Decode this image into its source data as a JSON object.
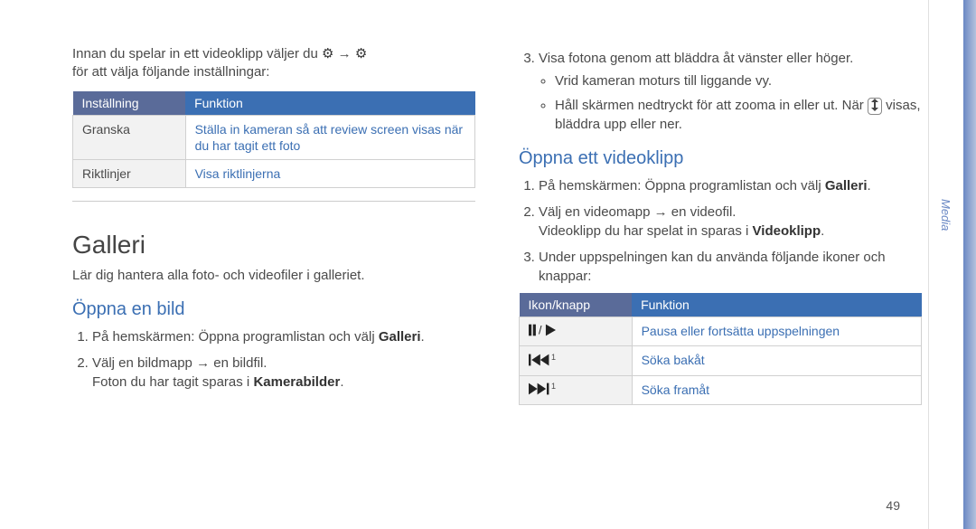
{
  "left": {
    "intro_a": "Innan du spelar in ett videoklipp väljer du ",
    "intro_arrow": " → ",
    "intro_b": "för att välja följande inställningar:",
    "table": {
      "head": {
        "c1": "Inställning",
        "c2": "Funktion"
      },
      "rows": [
        {
          "c1": "Granska",
          "c2": "Ställa in kameran så att review screen visas när du har tagit ett foto"
        },
        {
          "c1": "Riktlinjer",
          "c2": "Visa riktlinjerna"
        }
      ]
    },
    "h1": "Galleri",
    "h1_sub": "Lär dig hantera alla foto- och videofiler i galleriet.",
    "h2a": "Öppna en bild",
    "list1": {
      "i1a": "På hemskärmen: Öppna programlistan och välj ",
      "i1b": "Galleri",
      "i1c": ".",
      "i2a": "Välj en bildmapp → en bildfil.",
      "i2b_a": "Foton du har tagit sparas i ",
      "i2b_b": "Kamerabilder",
      "i2b_c": "."
    }
  },
  "right": {
    "step3_a": "Visa fotona genom att bläddra åt vänster eller höger.",
    "bullets1": [
      "Vrid kameran moturs till liggande vy."
    ],
    "bullet2_a": "Håll skärmen nedtryckt för att zooma in eller ut. När ",
    "bullet2_b": " visas, bläddra upp eller ner.",
    "h2b": "Öppna ett videoklipp",
    "list2": {
      "i1a": "På hemskärmen: Öppna programlistan och välj ",
      "i1b": "Galleri",
      "i1c": ".",
      "i2a": "Välj en videomapp → en videofil.",
      "i2b_a": "Videoklipp du har spelat in sparas i ",
      "i2b_b": "Videoklipp",
      "i2b_c": ".",
      "i3": "Under uppspelningen kan du använda följande ikoner och knappar:"
    },
    "table2": {
      "head": {
        "c1": "Ikon/knapp",
        "c2": "Funktion"
      },
      "rows": [
        {
          "c2": "Pausa eller fortsätta uppspelningen",
          "sup": ""
        },
        {
          "c2": "Söka bakåt",
          "sup": "1"
        },
        {
          "c2": "Söka framåt",
          "sup": "1"
        }
      ]
    }
  },
  "side_tab": "Media",
  "page_number": "49"
}
